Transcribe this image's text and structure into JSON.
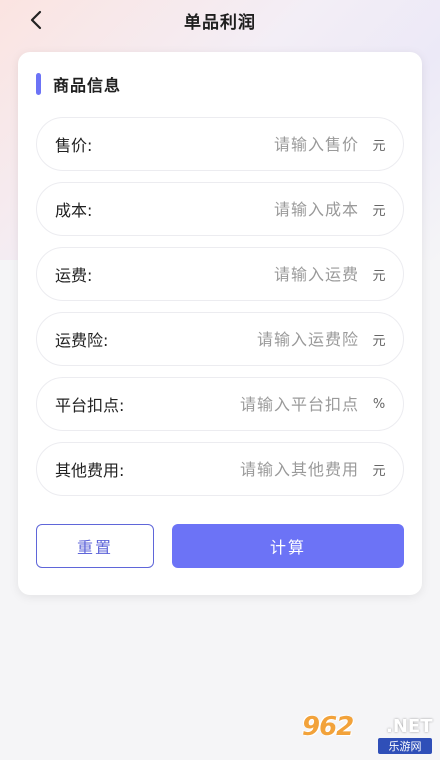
{
  "header": {
    "title": "单品利润",
    "back_icon": "chevron-left-icon"
  },
  "section": {
    "title": "商品信息",
    "accent_color": "#6c73f6"
  },
  "fields": [
    {
      "label": "售价:",
      "placeholder": "请输入售价",
      "value": "",
      "unit": "元"
    },
    {
      "label": "成本:",
      "placeholder": "请输入成本",
      "value": "",
      "unit": "元"
    },
    {
      "label": "运费:",
      "placeholder": "请输入运费",
      "value": "",
      "unit": "元"
    },
    {
      "label": "运费险:",
      "placeholder": "请输入运费险",
      "value": "",
      "unit": "元"
    },
    {
      "label": "平台扣点:",
      "placeholder": "请输入平台扣点",
      "value": "",
      "unit": "%"
    },
    {
      "label": "其他费用:",
      "placeholder": "请输入其他费用",
      "value": "",
      "unit": "元"
    }
  ],
  "actions": {
    "reset_label": "重置",
    "calc_label": "计算",
    "primary_color": "#6c73f6"
  },
  "watermark": {
    "logo": "962",
    "suffix": ".NET",
    "sub": "乐游网"
  }
}
